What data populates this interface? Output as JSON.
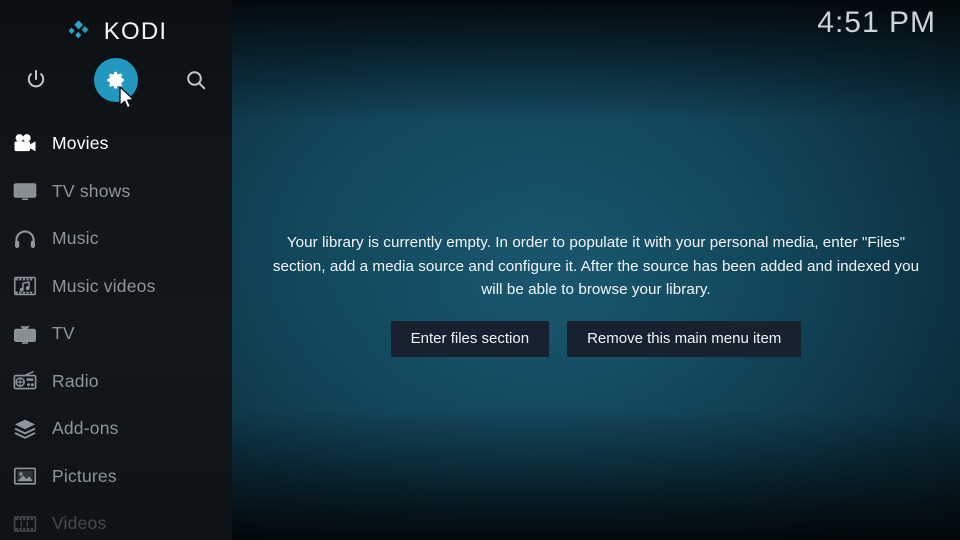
{
  "app": {
    "brand_name": "KODI",
    "clock": "4:51 PM",
    "accent_color": "#2298c0",
    "sidebar_bg": "#12171b",
    "background_color": "#103f50",
    "button_bg": "#17222e"
  },
  "toolbar": {
    "power_icon": "power-icon",
    "settings_icon": "gear-icon",
    "search_icon": "search-icon",
    "selected": "settings"
  },
  "sidebar": {
    "items": [
      {
        "label": "Movies",
        "icon": "movie-camera-icon",
        "selected": true,
        "dimmed": false
      },
      {
        "label": "TV shows",
        "icon": "television-icon",
        "selected": false,
        "dimmed": false
      },
      {
        "label": "Music",
        "icon": "headphones-icon",
        "selected": false,
        "dimmed": false
      },
      {
        "label": "Music videos",
        "icon": "film-note-icon",
        "selected": false,
        "dimmed": false
      },
      {
        "label": "TV",
        "icon": "tv-antenna-icon",
        "selected": false,
        "dimmed": false
      },
      {
        "label": "Radio",
        "icon": "radio-icon",
        "selected": false,
        "dimmed": false
      },
      {
        "label": "Add-ons",
        "icon": "addon-box-icon",
        "selected": false,
        "dimmed": false
      },
      {
        "label": "Pictures",
        "icon": "picture-icon",
        "selected": false,
        "dimmed": false
      },
      {
        "label": "Videos",
        "icon": "film-strip-icon",
        "selected": false,
        "dimmed": true
      }
    ]
  },
  "main": {
    "empty_message": "Your library is currently empty. In order to populate it with your personal media, enter \"Files\" section, add a media source and configure it. After the source has been added and indexed you will be able to browse your library.",
    "buttons": {
      "enter_files": "Enter files section",
      "remove_item": "Remove this main menu item"
    }
  }
}
